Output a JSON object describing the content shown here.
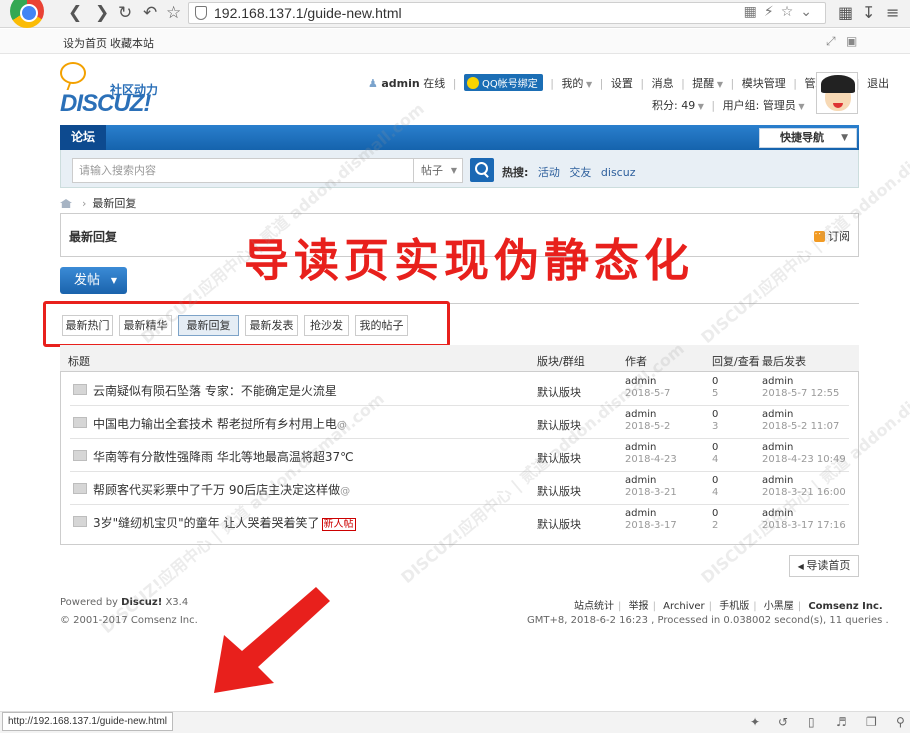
{
  "browser": {
    "url": "192.168.137.1/guide-new.html",
    "status_url": "http://192.168.137.1/guide-new.html"
  },
  "favbar": {
    "set_home": "设为首页",
    "bookmark": "收藏本站"
  },
  "logo": {
    "cn": "社区动力",
    "en": "DISCUZ!"
  },
  "user": {
    "name": "admin",
    "online": "在线",
    "qq_bind": "QQ帐号绑定",
    "menu": [
      "我的",
      "设置",
      "消息",
      "提醒",
      "模块管理",
      "管理中心",
      "退出"
    ],
    "credits": "积分: 49",
    "group": "用户组: 管理员"
  },
  "nav": {
    "forum_tab": "论坛",
    "quick_nav": "快捷导航"
  },
  "search": {
    "placeholder": "请输入搜索内容",
    "type": "帖子",
    "hot_label": "热搜:",
    "hot_terms": [
      "活动",
      "交友",
      "discuz"
    ]
  },
  "breadcrumb": {
    "current": "最新回复"
  },
  "page": {
    "title": "最新回复",
    "subscribe": "订阅",
    "overlay": "导读页实现伪静态化"
  },
  "post_button": "发帖",
  "filter_tabs": [
    "最新热门",
    "最新精华",
    "最新回复",
    "最新发表",
    "抢沙发",
    "我的帖子"
  ],
  "table": {
    "headers": {
      "title": "标题",
      "forum": "版块/群组",
      "author": "作者",
      "replies": "回复/查看",
      "last": "最后发表"
    },
    "rows": [
      {
        "subject": "云南疑似有陨石坠落 专家：不能确定是火流星",
        "attach": "",
        "badge": "",
        "forum": "默认版块",
        "author": "admin",
        "date": "2018-5-7",
        "replies": "0",
        "views": "5",
        "last_user": "admin",
        "last_time": "2018-5-7 12:55"
      },
      {
        "subject": "中国电力输出全套技术 帮老挝所有乡村用上电",
        "attach": "@",
        "badge": "",
        "forum": "默认版块",
        "author": "admin",
        "date": "2018-5-2",
        "replies": "0",
        "views": "3",
        "last_user": "admin",
        "last_time": "2018-5-2 11:07"
      },
      {
        "subject": "华南等有分散性强降雨 华北等地最高温将超37℃",
        "attach": "",
        "badge": "",
        "forum": "默认版块",
        "author": "admin",
        "date": "2018-4-23",
        "replies": "0",
        "views": "4",
        "last_user": "admin",
        "last_time": "2018-4-23 10:49"
      },
      {
        "subject": "帮顾客代买彩票中了千万 90后店主决定这样做",
        "attach": "@",
        "badge": "",
        "forum": "默认版块",
        "author": "admin",
        "date": "2018-3-21",
        "replies": "0",
        "views": "4",
        "last_user": "admin",
        "last_time": "2018-3-21 16:00"
      },
      {
        "subject": "3岁\"缝纫机宝贝\"的童年 让人哭着哭着笑了",
        "attach": "",
        "badge": "新人帖",
        "forum": "默认版块",
        "author": "admin",
        "date": "2018-3-17",
        "replies": "0",
        "views": "2",
        "last_user": "admin",
        "last_time": "2018-3-17 17:16"
      }
    ]
  },
  "back_button": "导读首页",
  "footer": {
    "powered": "Powered by",
    "brand": "Discuz!",
    "version": "X3.4",
    "copyright": "© 2001-2017 Comsenz Inc.",
    "links": [
      "站点统计",
      "举报",
      "Archiver",
      "手机版",
      "小黑屋",
      "Comsenz Inc."
    ],
    "stats": "GMT+8, 2018-6-2 16:23 , Processed in 0.038002 second(s), 11 queries ."
  },
  "watermark": "DISCUZ!应用中心 | 贰道 addon.dismall.com",
  "colors": {
    "brand_blue": "#1563ad",
    "annotation_red": "#e8201c"
  }
}
